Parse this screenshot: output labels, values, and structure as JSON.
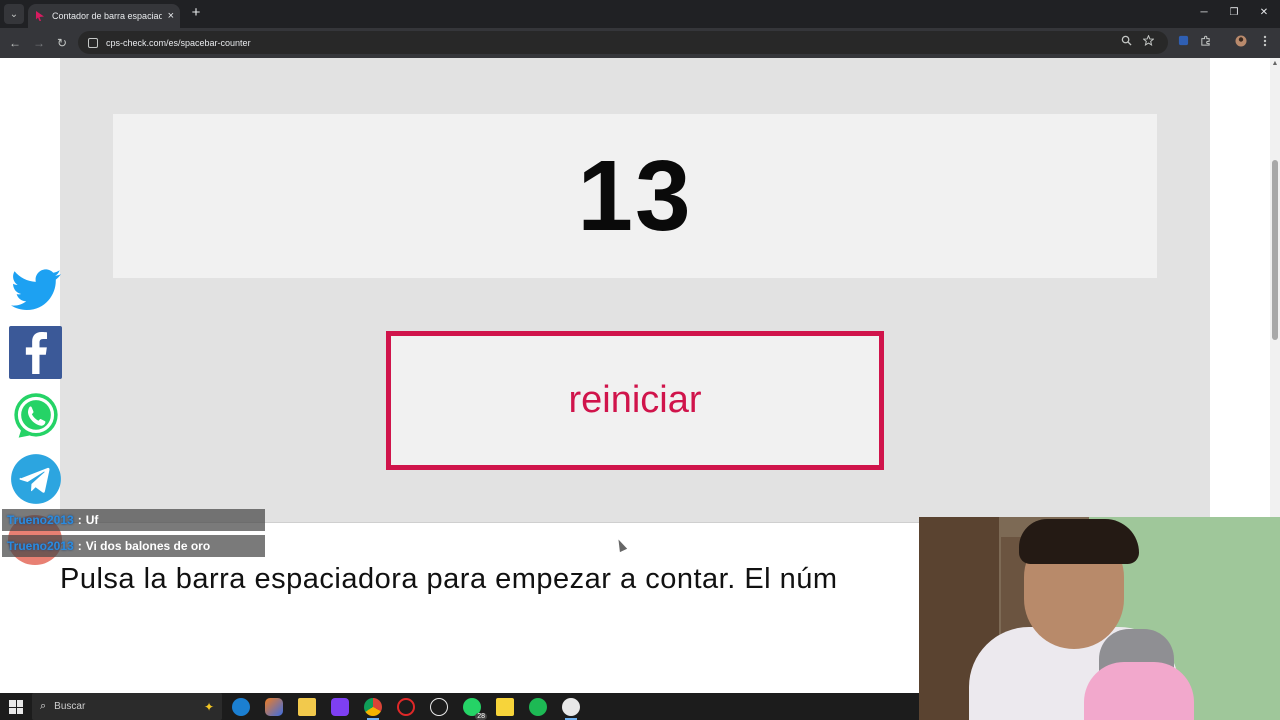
{
  "browser": {
    "tab_title": "Contador de barra espaciadora",
    "tab_close": "×",
    "new_tab": "+",
    "tab_list": "⌄",
    "url": "cps-check.com/es/spacebar-counter",
    "window": {
      "minimize": "─",
      "restore": "❐",
      "close": "✕"
    },
    "nav": {
      "back": "←",
      "forward": "→",
      "reload": "↻"
    }
  },
  "page": {
    "counter_value": "13",
    "reset_label": "reiniciar",
    "instructions": "Pulsa la barra espaciadora para empezar a contar. El núm"
  },
  "share": [
    "twitter-icon",
    "facebook-icon",
    "whatsapp-icon",
    "telegram-icon"
  ],
  "chat": [
    {
      "user": "Trueno2013",
      "sep": ":",
      "text": "Uf"
    },
    {
      "user": "Trueno2013",
      "sep": ":",
      "text": "Vi dos balones de oro"
    }
  ],
  "taskbar": {
    "search_label": "Buscar",
    "whatsapp_badge": "28"
  },
  "colors": {
    "accent_red": "#d0144b",
    "facebook_blue": "#3b5998",
    "twitter_blue": "#1da1f2",
    "whatsapp_green": "#25d366",
    "telegram_blue": "#2ca5e0"
  }
}
